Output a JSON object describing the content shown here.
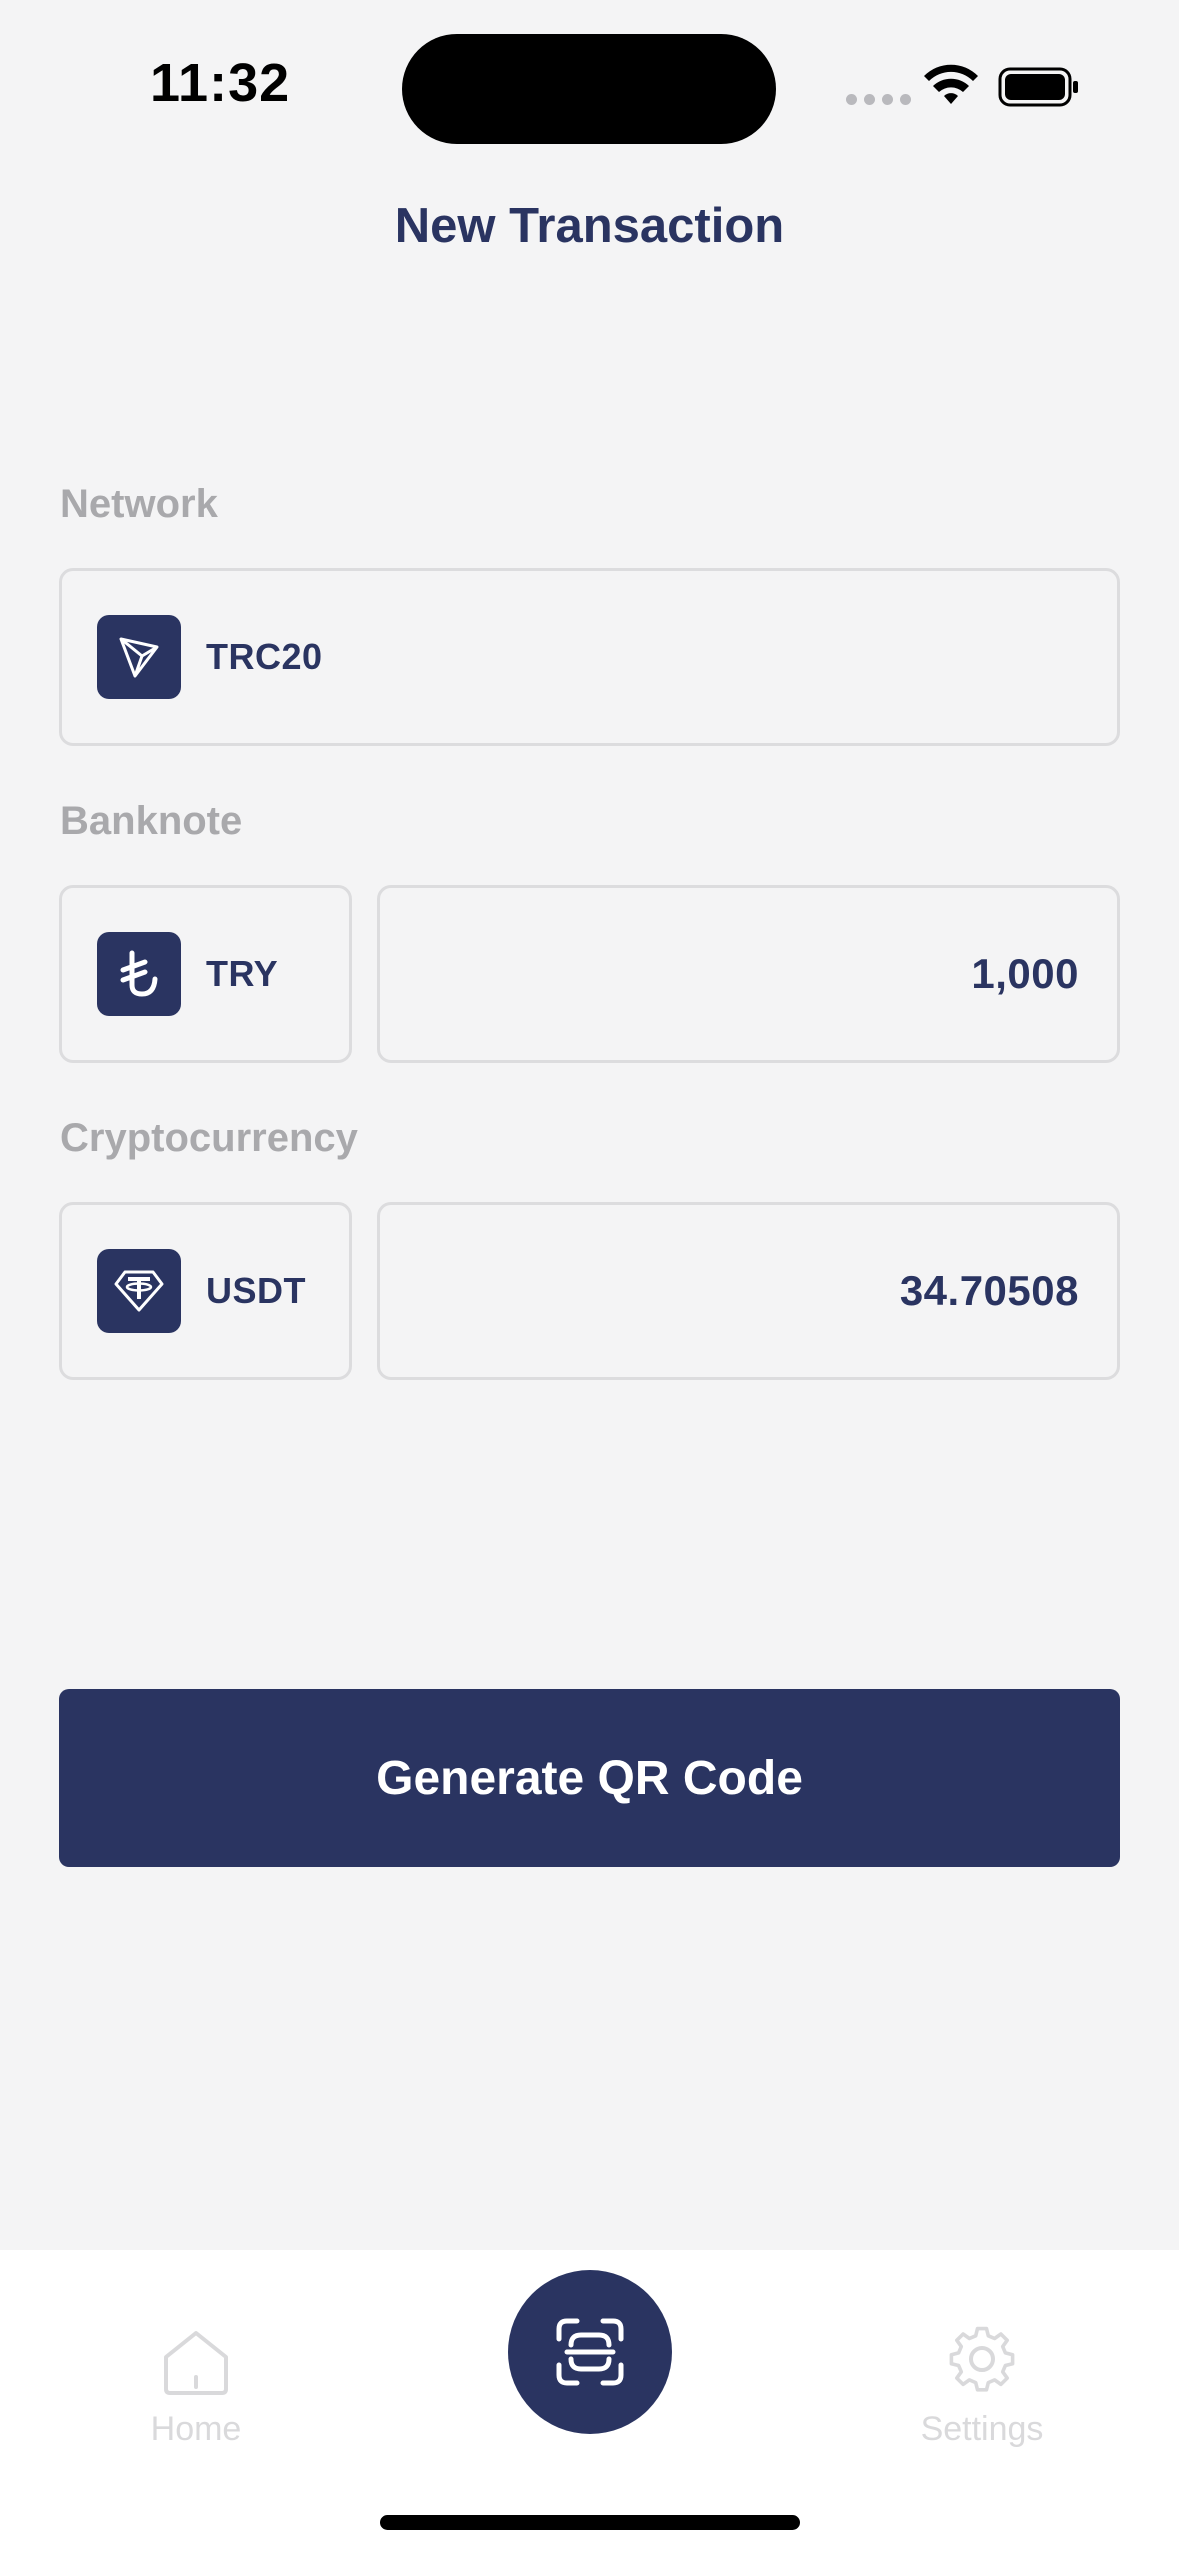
{
  "status_bar": {
    "time": "11:32"
  },
  "header": {
    "title": "New Transaction"
  },
  "network": {
    "label": "Network",
    "selected": "TRC20",
    "icon": "tron-icon"
  },
  "banknote": {
    "label": "Banknote",
    "currency": "TRY",
    "icon": "lira-icon",
    "amount": "1,000"
  },
  "cryptocurrency": {
    "label": "Cryptocurrency",
    "currency": "USDT",
    "icon": "tether-icon",
    "amount": "34.70508"
  },
  "actions": {
    "generate_label": "Generate QR Code"
  },
  "tab_bar": {
    "items": [
      {
        "label": "Home",
        "icon": "home-icon"
      },
      {
        "label": "",
        "icon": "scan-icon"
      },
      {
        "label": "Settings",
        "icon": "gear-icon"
      }
    ]
  },
  "colors": {
    "primary": "#2a3461",
    "background": "#f4f4f5",
    "label_gray": "#a9a9ac",
    "border": "#dcdcde",
    "inactive_tab": "#d9d9db"
  }
}
